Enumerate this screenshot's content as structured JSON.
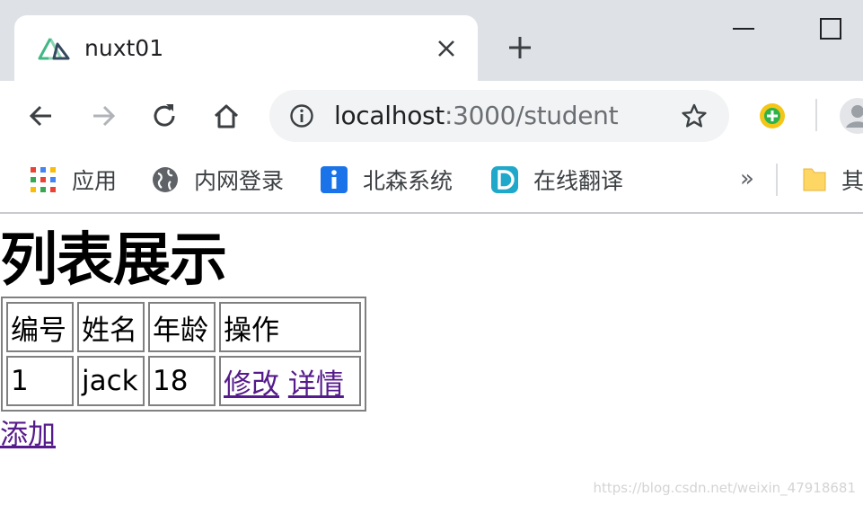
{
  "browser": {
    "tab": {
      "title": "nuxt01",
      "favicon": "nuxt-logo-icon"
    },
    "address": {
      "host": "localhost",
      "rest": ":3000/student"
    },
    "bookmarks": [
      {
        "label": "应用",
        "icon": "apps-grid-icon"
      },
      {
        "label": "内网登录",
        "icon": "globe-icon"
      },
      {
        "label": "北森系统",
        "icon": "info-i-icon"
      },
      {
        "label": "在线翻译",
        "icon": "translate-d-icon"
      }
    ],
    "more_bookmarks": "»",
    "other_bookmarks": "其",
    "colors": {
      "tabstrip": "#dee1e6",
      "omnibox": "#f1f3f4",
      "link": "#551a8b",
      "nuxt_green": "#41b883"
    }
  },
  "page": {
    "title": "列表展示",
    "table": {
      "headers": [
        "编号",
        "姓名",
        "年龄",
        "操作"
      ],
      "rows": [
        {
          "id": "1",
          "name": "jack",
          "age": "18",
          "actions": [
            "修改",
            "详情"
          ]
        }
      ]
    },
    "add_link": "添加"
  },
  "watermark": "https://blog.csdn.net/weixin_47918681"
}
